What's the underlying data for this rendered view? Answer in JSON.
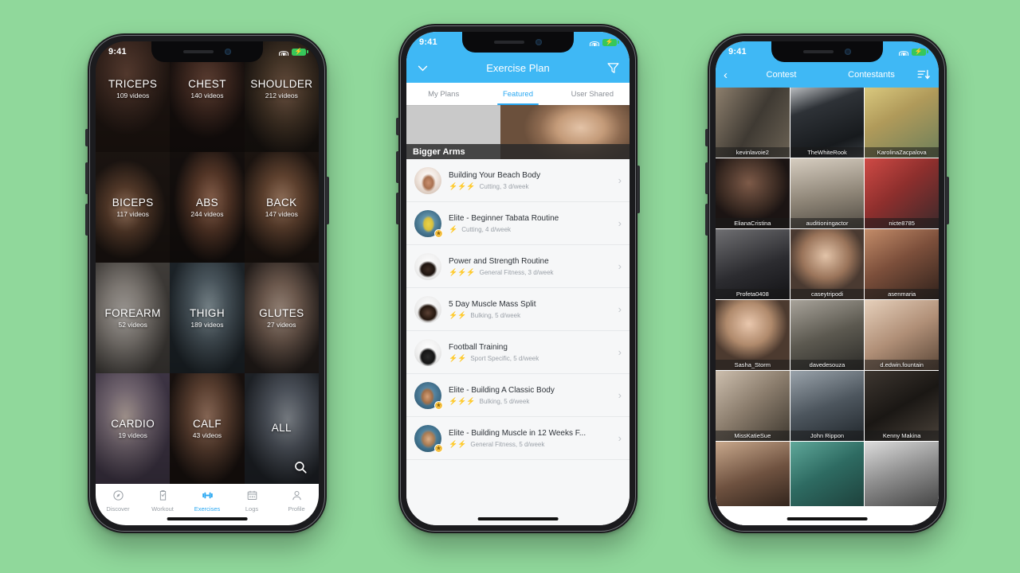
{
  "background_color": "#90d89b",
  "accent_color": "#3fb8f5",
  "status_bar": {
    "time": "9:41"
  },
  "phone1": {
    "categories": [
      {
        "name": "TRICEPS",
        "videos": "109 videos"
      },
      {
        "name": "CHEST",
        "videos": "140 videos"
      },
      {
        "name": "SHOULDER",
        "videos": "212 videos"
      },
      {
        "name": "BICEPS",
        "videos": "117 videos"
      },
      {
        "name": "ABS",
        "videos": "244 videos"
      },
      {
        "name": "BACK",
        "videos": "147 videos"
      },
      {
        "name": "FOREARM",
        "videos": "52 videos"
      },
      {
        "name": "THIGH",
        "videos": "189 videos"
      },
      {
        "name": "GLUTES",
        "videos": "27 videos"
      },
      {
        "name": "CARDIO",
        "videos": "19 videos"
      },
      {
        "name": "CALF",
        "videos": "43 videos"
      },
      {
        "name": "ALL",
        "videos": ""
      }
    ],
    "search_icon": "search-icon",
    "tabbar": [
      {
        "label": "Discover",
        "icon": "compass-icon",
        "active": false
      },
      {
        "label": "Workout",
        "icon": "clipboard-check-icon",
        "active": false
      },
      {
        "label": "Exercises",
        "icon": "dumbbell-icon",
        "active": true
      },
      {
        "label": "Logs",
        "icon": "calendar-icon",
        "active": false
      },
      {
        "label": "Profile",
        "icon": "person-icon",
        "active": false
      }
    ]
  },
  "phone2": {
    "nav": {
      "title": "Exercise Plan",
      "left_icon": "chevron-down-icon",
      "right_icon": "filter-icon"
    },
    "tabs": [
      {
        "label": "My Plans",
        "active": false
      },
      {
        "label": "Featured",
        "active": true
      },
      {
        "label": "User Shared",
        "active": false
      }
    ],
    "banner": {
      "caption": "Bigger Arms"
    },
    "plans": [
      {
        "title": "Building Your Beach Body",
        "bolts": 3,
        "meta": "Cutting, 3 d/week",
        "badge": false
      },
      {
        "title": "Elite - Beginner Tabata Routine",
        "bolts": 1,
        "meta": "Cutting, 4 d/week",
        "badge": true
      },
      {
        "title": "Power and Strength Routine",
        "bolts": 3,
        "meta": "General Fitness, 3 d/week",
        "badge": false
      },
      {
        "title": "5 Day Muscle Mass Split",
        "bolts": 2,
        "meta": "Bulking, 5 d/week",
        "badge": false
      },
      {
        "title": "Football Training",
        "bolts": 2,
        "meta": "Sport Specific, 5 d/week",
        "badge": false
      },
      {
        "title": "Elite - Building A Classic Body",
        "bolts": 3,
        "meta": "Bulking, 5 d/week",
        "badge": true
      },
      {
        "title": "Elite - Building Muscle in 12 Weeks F...",
        "bolts": 2,
        "meta": "General Fitness, 5 d/week",
        "badge": true
      }
    ],
    "bolt_glyph": "⚡",
    "chevron_glyph": "›"
  },
  "phone3": {
    "nav": {
      "back_icon": "chevron-left-icon",
      "left_label": "Contest",
      "right_label": "Contestants",
      "sort_icon": "sort-descending-icon"
    },
    "contestants": [
      "kevinlavoie2",
      "TheWhiteRook",
      "KarolinaZacpalova",
      "ElianaCristina",
      "auditioningactor",
      "nicte8785",
      "Profeta0408",
      "caseytripodi",
      "asenmaria",
      "Sasha_Storm",
      "davedesouza",
      "d.edwin.fountain",
      "MissKatieSue",
      "John Rippon",
      "Kenny Makina",
      "",
      "",
      ""
    ]
  }
}
